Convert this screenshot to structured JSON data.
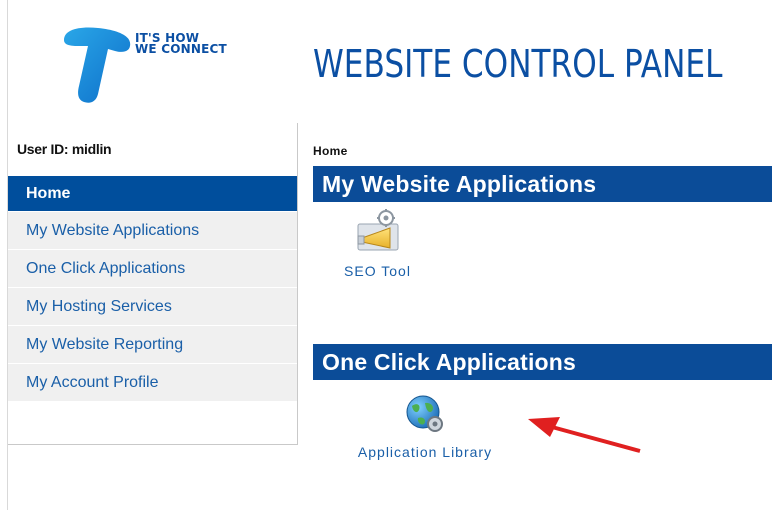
{
  "header": {
    "tagline_line1": "IT'S HOW",
    "tagline_line2": "WE CONNECT",
    "title": "WEBSITE CONTROL PANEL",
    "logo_icon": "telstra-logo-icon",
    "brand_color": "#0b4fa3"
  },
  "sidebar": {
    "user_id": "User ID: midlin",
    "items": [
      {
        "label": "Home",
        "active": true
      },
      {
        "label": "My Website Applications"
      },
      {
        "label": "One Click Applications"
      },
      {
        "label": "My Hosting Services"
      },
      {
        "label": "My Website Reporting"
      },
      {
        "label": "My Account Profile"
      }
    ],
    "active_color": "#004e9c"
  },
  "main": {
    "breadcrumb": "Home",
    "sections": [
      {
        "title": "My Website Applications",
        "apps": [
          {
            "label": "SEO Tool",
            "icon": "seo-tool-icon"
          }
        ]
      },
      {
        "title": "One Click Applications",
        "apps": [
          {
            "label": "Application Library",
            "icon": "globe-gear-icon"
          }
        ]
      }
    ],
    "annotation": "red-arrow-icon"
  }
}
